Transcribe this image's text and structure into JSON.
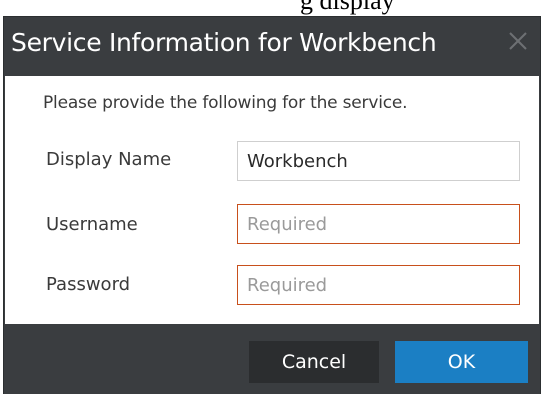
{
  "background": {
    "partial_text": "g    display"
  },
  "dialog": {
    "title": "Service Information for Workbench",
    "intro": "Please provide the following for the service.",
    "fields": [
      {
        "label": "Display Name",
        "value": "Workbench",
        "placeholder": ""
      },
      {
        "label": "Username",
        "value": "",
        "placeholder": "Required"
      },
      {
        "label": "Password",
        "value": "",
        "placeholder": "Required"
      }
    ],
    "buttons": {
      "cancel": "Cancel",
      "ok": "OK"
    }
  },
  "colors": {
    "dialog_chrome": "#3a3d40",
    "required_border": "#c8501c",
    "primary_button": "#1b7fc4",
    "secondary_button": "#2b2d2f"
  },
  "icons": {
    "close": "close-icon"
  }
}
